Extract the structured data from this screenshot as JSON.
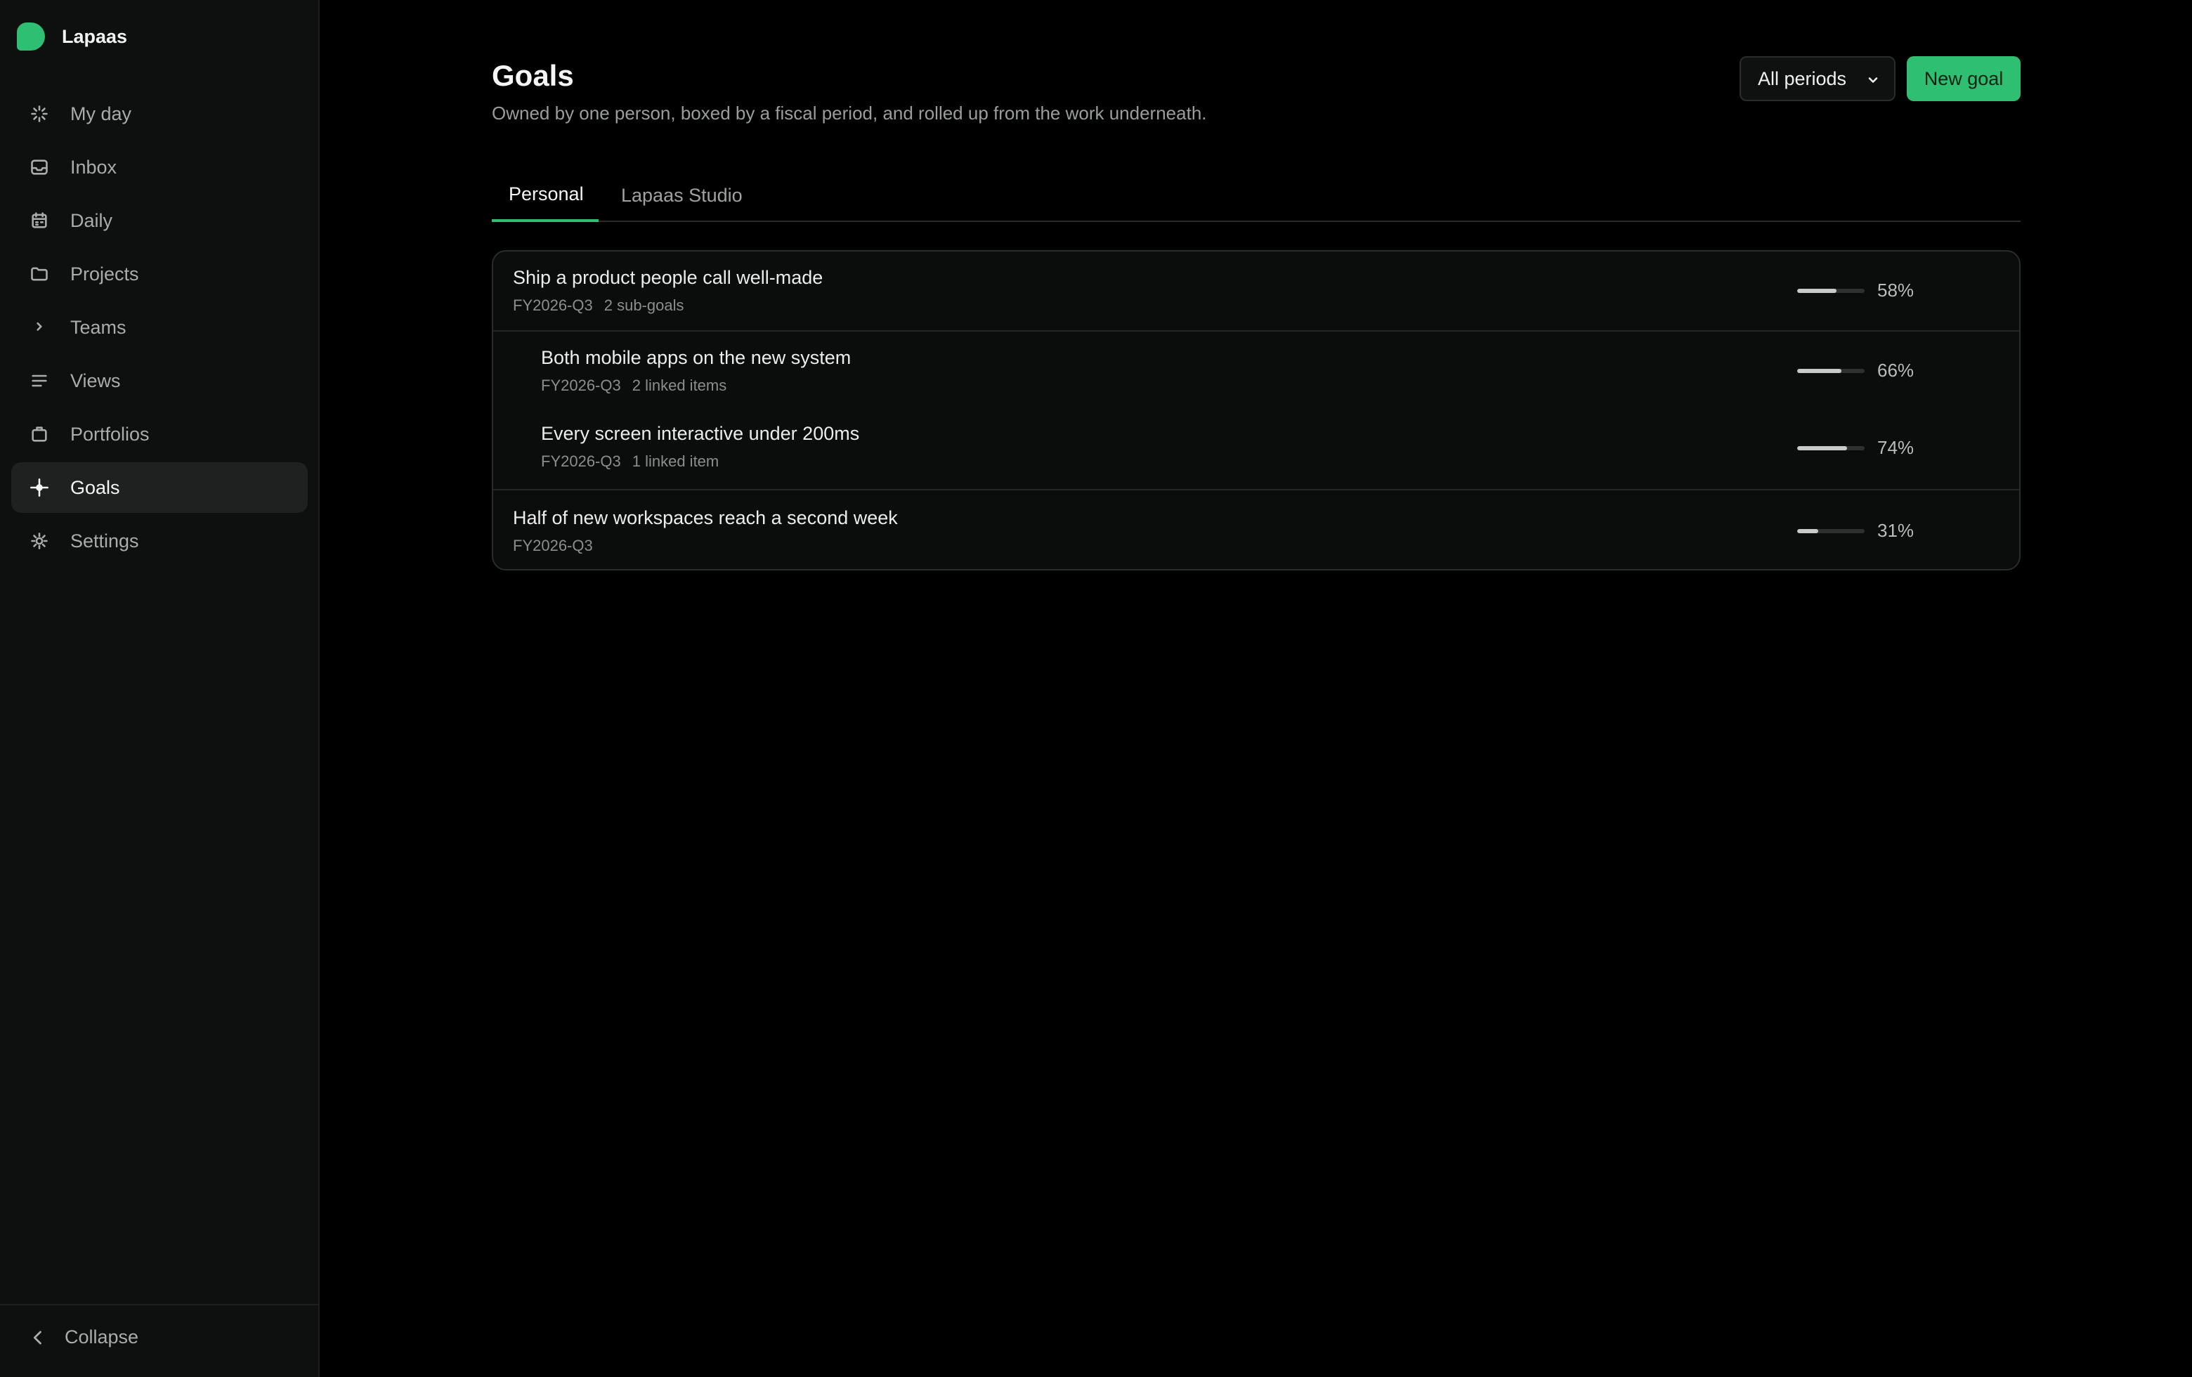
{
  "app": {
    "name": "Lapaas"
  },
  "sidebar": {
    "items": [
      {
        "label": "My day",
        "icon": "sparkle-icon",
        "active": false
      },
      {
        "label": "Inbox",
        "icon": "inbox-icon",
        "active": false
      },
      {
        "label": "Daily",
        "icon": "calendar-icon",
        "active": false
      },
      {
        "label": "Projects",
        "icon": "folder-icon",
        "active": false
      },
      {
        "label": "Teams",
        "icon": "chevron-right-icon",
        "active": false
      },
      {
        "label": "Views",
        "icon": "list-icon",
        "active": false
      },
      {
        "label": "Portfolios",
        "icon": "briefcase-icon",
        "active": false
      },
      {
        "label": "Goals",
        "icon": "target-icon",
        "active": true
      },
      {
        "label": "Settings",
        "icon": "gear-icon",
        "active": false
      }
    ],
    "collapse_label": "Collapse"
  },
  "header": {
    "title": "Goals",
    "subtitle": "Owned by one person, boxed by a fiscal period, and rolled up from the work underneath.",
    "period_select": "All periods",
    "new_goal_label": "New goal"
  },
  "tabs": [
    {
      "label": "Personal",
      "active": true
    },
    {
      "label": "Lapaas Studio",
      "active": false
    }
  ],
  "goals": [
    {
      "title": "Ship a product people call well-made",
      "period": "FY2026-Q3",
      "detail": "2 sub-goals",
      "progress": 58,
      "progress_label": "58%",
      "level": 0
    },
    {
      "title": "Both mobile apps on the new system",
      "period": "FY2026-Q3",
      "detail": "2 linked items",
      "progress": 66,
      "progress_label": "66%",
      "level": 1
    },
    {
      "title": "Every screen interactive under 200ms",
      "period": "FY2026-Q3",
      "detail": "1 linked item",
      "progress": 74,
      "progress_label": "74%",
      "level": 1
    },
    {
      "title": "Half of new workspaces reach a second week",
      "period": "FY2026-Q3",
      "detail": "",
      "progress": 31,
      "progress_label": "31%",
      "level": 0
    }
  ],
  "colors": {
    "accent": "#2fbf72",
    "background": "#000000",
    "sidebar": "#0e0f0f"
  }
}
